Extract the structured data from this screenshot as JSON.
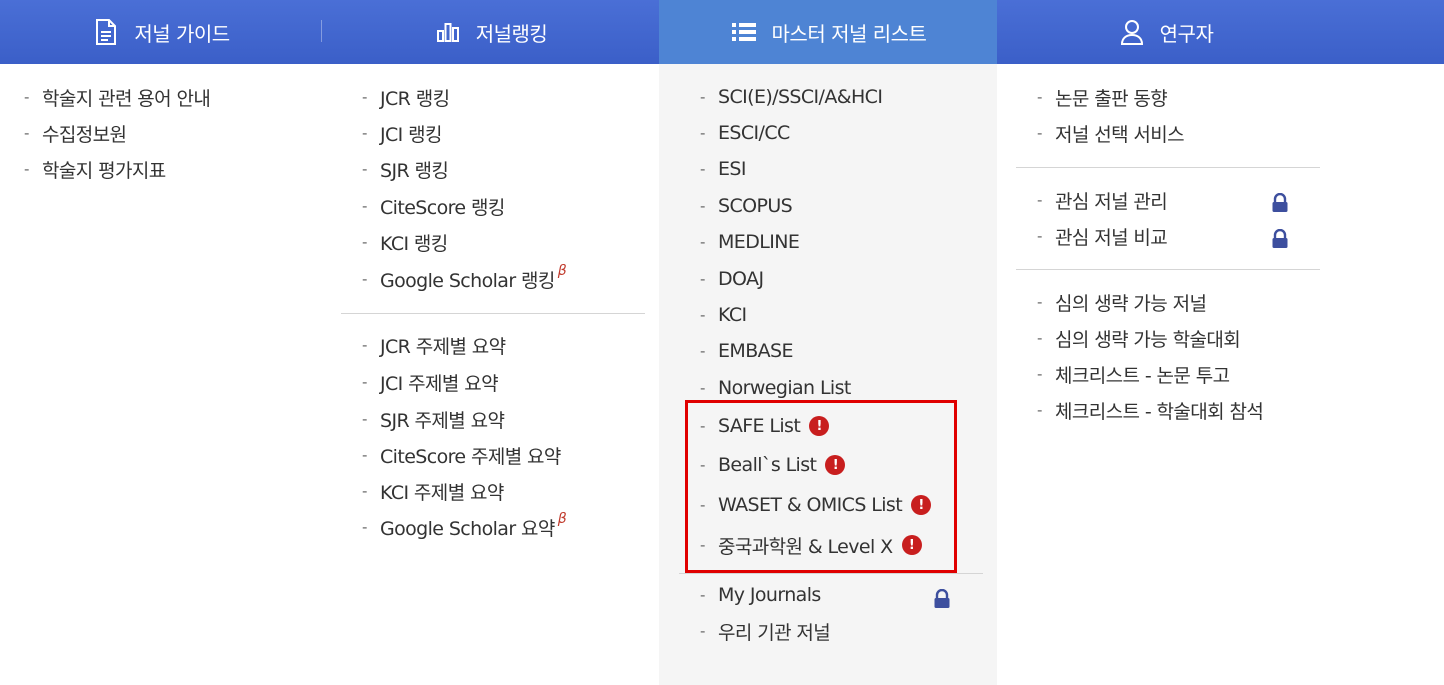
{
  "nav": {
    "tabs": [
      {
        "label": "저널 가이드",
        "icon": "document-icon"
      },
      {
        "label": "저널랭킹",
        "icon": "bar-chart-icon"
      },
      {
        "label": "마스터 저널 리스트",
        "icon": "list-icon"
      },
      {
        "label": "연구자",
        "icon": "user-icon"
      }
    ]
  },
  "col1": {
    "items": [
      "학술지 관련 용어 안내",
      "수집정보원",
      "학술지 평가지표"
    ]
  },
  "col2": {
    "group1": [
      "JCR 랭킹",
      "JCI 랭킹",
      "SJR 랭킹",
      "CiteScore 랭킹",
      "KCI 랭킹",
      "Google Scholar 랭킹"
    ],
    "group2": [
      "JCR 주제별 요약",
      "JCI 주제별 요약",
      "SJR 주제별 요약",
      "CiteScore 주제별 요약",
      "KCI 주제별 요약",
      "Google Scholar 요약"
    ],
    "beta": "β"
  },
  "col3": {
    "group1": [
      "SCI(E)/SSCI/A&HCI",
      "ESCI/CC",
      "ESI",
      "SCOPUS",
      "MEDLINE",
      "DOAJ",
      "KCI",
      "EMBASE",
      "Norwegian List"
    ],
    "warning_items": [
      "SAFE List",
      "Beall`s List",
      "WASET & OMICS List",
      "중국과학원 & Level X"
    ],
    "warn_glyph": "!",
    "group2": [
      "My Journals",
      "우리 기관 저널"
    ]
  },
  "col4": {
    "group1": [
      "논문 출판 동향",
      "저널 선택 서비스"
    ],
    "group2": [
      "관심 저널 관리",
      "관심 저널 비교"
    ],
    "group3": [
      "심의 생략 가능 저널",
      "심의 생략 가능 학술대회",
      "체크리스트 - 논문 투고",
      "체크리스트 - 학술대회 참석"
    ]
  },
  "dash": "-",
  "colors": {
    "nav": "#3b5fc8",
    "active_tab": "#4e84d4",
    "highlight": "#e00000",
    "warn": "#c81e1e",
    "lock": "#3d4f9e"
  }
}
